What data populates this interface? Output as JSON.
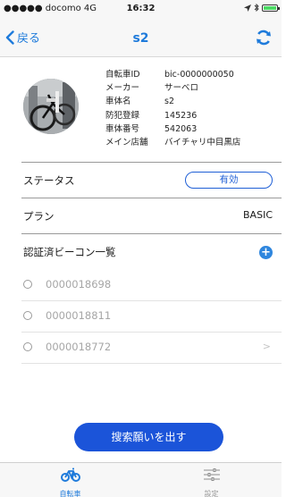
{
  "status_bar": {
    "carrier": "●●●●● docomo  4G",
    "time": "16:32"
  },
  "nav": {
    "back_label": "戻る",
    "title": "s2"
  },
  "bike": {
    "fields": [
      {
        "key": "自転車ID",
        "value": "bic-0000000050"
      },
      {
        "key": "メーカー",
        "value": "サーベロ"
      },
      {
        "key": "車体名",
        "value": "s2"
      },
      {
        "key": "防犯登録",
        "value": "145236"
      },
      {
        "key": "車体番号",
        "value": "542063"
      },
      {
        "key": "メイン店舗",
        "value": "バイチャリ中目黒店"
      }
    ]
  },
  "status": {
    "label": "ステータス",
    "value": "有効"
  },
  "plan": {
    "label": "プラン",
    "value": "BASIC"
  },
  "beacons": {
    "label": "認証済ビーコン一覧",
    "items": [
      "0000018698",
      "0000018811",
      "0000018772"
    ]
  },
  "search_button": {
    "label": "搜索願いを出す"
  },
  "tabs": [
    {
      "label": "自転車",
      "icon": "bicycle-icon",
      "active": true
    },
    {
      "label": "設定",
      "icon": "sliders-icon",
      "active": false
    }
  ],
  "colors": {
    "accent": "#1f7bdb",
    "button": "#1b54d9",
    "status_border": "#1f5fd6",
    "add": "#2e86de"
  }
}
